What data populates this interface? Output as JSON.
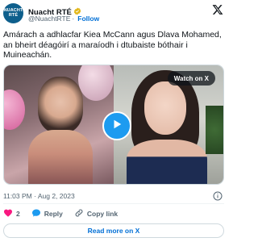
{
  "tweet": {
    "avatar_text_line1": "NUACHT",
    "avatar_text_line2": "RTÉ",
    "display_name": "Nuacht RTÉ",
    "handle": "@NuachtRTE",
    "separator": "·",
    "follow_label": "Follow",
    "text": "Amárach a adhlacfar Kiea McCann agus Dlava Mohamed, an bheirt déagóirí a maraíodh i dtubaiste bóthair i Muineachán.",
    "timestamp": "11:03 PM · Aug 2, 2023"
  },
  "media": {
    "watch_label": "Watch on X"
  },
  "actions": {
    "like_count": "2",
    "reply_label": "Reply",
    "copy_link_label": "Copy link"
  },
  "read_more_label": "Read more on X",
  "colors": {
    "accent": "#1d9bf0",
    "link": "#006fd6",
    "like": "#f91880",
    "avatar_bg": "#0e5f8c"
  },
  "icons": {
    "brand": "x-logo-icon",
    "verified": "verified-badge-icon",
    "info": "info-icon",
    "like": "heart-icon",
    "reply": "reply-bubble-icon",
    "copy": "link-icon",
    "play": "play-icon"
  }
}
